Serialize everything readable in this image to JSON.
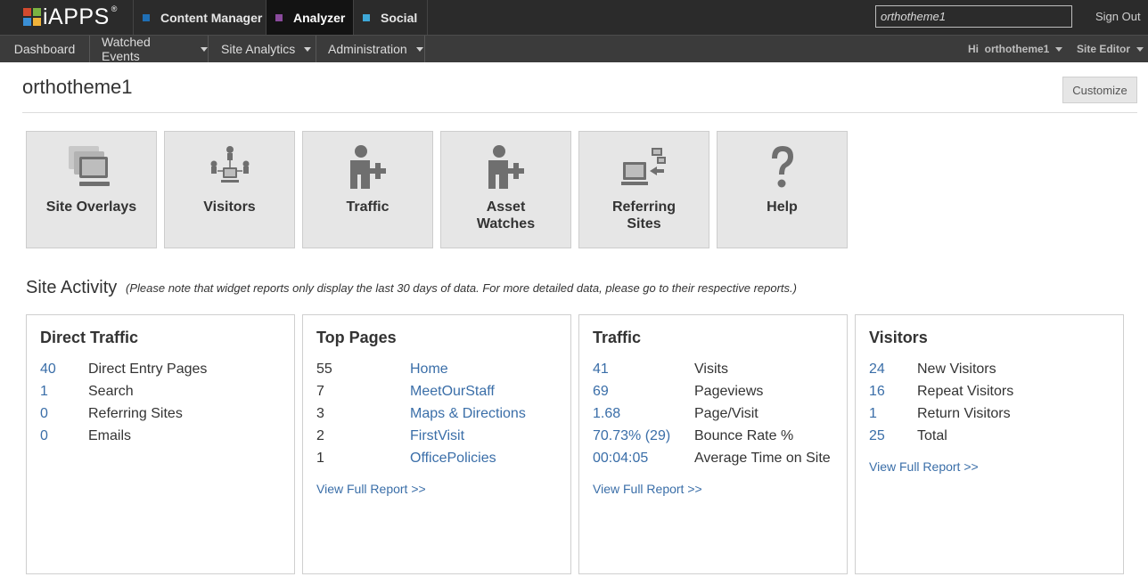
{
  "brand": {
    "logo_text": "iAPPS",
    "logo_reg": "®",
    "logo_colors": [
      "#d24a2e",
      "#7bb342",
      "#3a8fd6",
      "#f0b33a"
    ]
  },
  "products": [
    {
      "label": "Content Manager",
      "color": "#1f6fb5",
      "active": false
    },
    {
      "label": "Analyzer",
      "color": "#8a4a9c",
      "active": true
    },
    {
      "label": "Social",
      "color": "#3ea8d8",
      "active": false
    }
  ],
  "search": {
    "value": "orthotheme1"
  },
  "sign_out": "Sign Out",
  "subnav": {
    "items": [
      {
        "label": "Dashboard",
        "dropdown": false
      },
      {
        "label": "Watched Events",
        "dropdown": true
      },
      {
        "label": "Site Analytics",
        "dropdown": true
      },
      {
        "label": "Administration",
        "dropdown": true
      }
    ],
    "user_greeting": "Hi  orthotheme1",
    "role": "Site Editor"
  },
  "page": {
    "title": "orthotheme1",
    "customize_label": "Customize"
  },
  "tiles": [
    {
      "label": "Site Overlays",
      "icon": "site-overlays-icon"
    },
    {
      "label": "Visitors",
      "icon": "visitors-icon"
    },
    {
      "label": "Traffic",
      "icon": "traffic-icon"
    },
    {
      "label": "Asset\nWatches",
      "icon": "asset-watches-icon"
    },
    {
      "label": "Referring\nSites",
      "icon": "referring-sites-icon"
    },
    {
      "label": "Help",
      "icon": "help-icon"
    }
  ],
  "site_activity": {
    "title": "Site Activity",
    "note": "(Please note that widget reports only display the last 30 days of data. For more detailed data, please go to their respective reports.)"
  },
  "widgets": {
    "direct_traffic": {
      "title": "Direct Traffic",
      "rows": [
        {
          "value": "40",
          "label": "Direct Entry Pages"
        },
        {
          "value": "1",
          "label": "Search"
        },
        {
          "value": "0",
          "label": "Referring Sites"
        },
        {
          "value": "0",
          "label": "Emails"
        }
      ]
    },
    "top_pages": {
      "title": "Top Pages",
      "rows": [
        {
          "value": "55",
          "label": "Home"
        },
        {
          "value": "7",
          "label": "MeetOurStaff"
        },
        {
          "value": "3",
          "label": "Maps & Directions"
        },
        {
          "value": "2",
          "label": "FirstVisit"
        },
        {
          "value": "1",
          "label": "OfficePolicies"
        }
      ],
      "link": "View Full Report >>"
    },
    "traffic": {
      "title": "Traffic",
      "rows": [
        {
          "value": "41",
          "label": "Visits"
        },
        {
          "value": "69",
          "label": "Pageviews"
        },
        {
          "value": "1.68",
          "label": "Page/Visit"
        },
        {
          "value": "70.73% (29)",
          "label": "Bounce Rate %"
        },
        {
          "value": "00:04:05",
          "label": "Average Time on Site"
        }
      ],
      "link": "View Full Report >>"
    },
    "visitors": {
      "title": "Visitors",
      "rows": [
        {
          "value": "24",
          "label": "New Visitors"
        },
        {
          "value": "16",
          "label": "Repeat Visitors"
        },
        {
          "value": "1",
          "label": "Return Visitors"
        },
        {
          "value": "25",
          "label": "Total"
        }
      ],
      "link": "View Full Report >>"
    }
  }
}
